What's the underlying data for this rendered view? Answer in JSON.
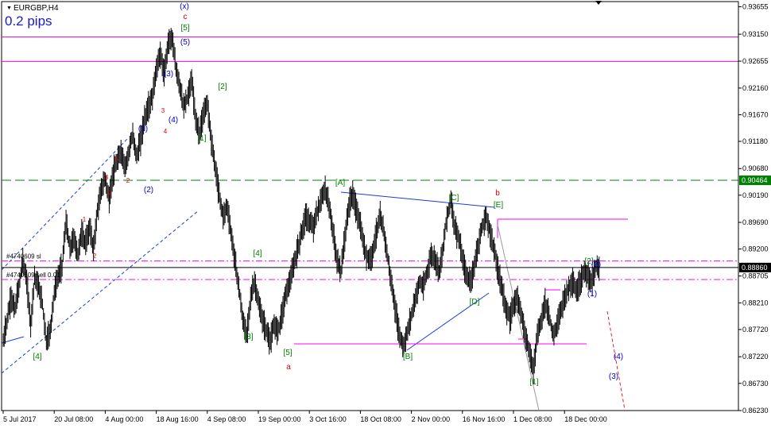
{
  "window": {
    "symbol_title": "EURGBP,H4",
    "spread_label": "0.2 pips",
    "menu_icon": "triangle-down-icon"
  },
  "chart_data": {
    "type": "candlestick-line",
    "symbol": "EURGBP",
    "timeframe": "H4",
    "ylim": [
      0.8623,
      0.9375
    ],
    "y_ticks": [
      "0.93655",
      "0.93150",
      "0.92655",
      "0.92160",
      "0.91670",
      "0.91180",
      "0.90680",
      "0.90190",
      "0.89690",
      "0.89200",
      "0.88705",
      "0.88210",
      "0.87720",
      "0.87220",
      "0.86730",
      "0.86230"
    ],
    "x_ticks": [
      "5 Jul 2017",
      "20 Jul 08:00",
      "4 Aug 00:00",
      "18 Aug 16:00",
      "4 Sep 08:00",
      "19 Sep 00:00",
      "3 Oct 16:00",
      "18 Oct 08:00",
      "2 Nov 00:00",
      "16 Nov 16:00",
      "1 Dec 08:00",
      "18 Dec 00:00"
    ],
    "price_path": [
      0.875,
      0.879,
      0.883,
      0.881,
      0.885,
      0.89,
      0.886,
      0.878,
      0.887,
      0.885,
      0.882,
      0.875,
      0.877,
      0.884,
      0.887,
      0.889,
      0.897,
      0.892,
      0.894,
      0.891,
      0.895,
      0.893,
      0.896,
      0.892,
      0.899,
      0.903,
      0.905,
      0.901,
      0.906,
      0.908,
      0.91,
      0.907,
      0.91,
      0.913,
      0.909,
      0.912,
      0.916,
      0.918,
      0.92,
      0.925,
      0.928,
      0.924,
      0.93,
      0.931,
      0.925,
      0.922,
      0.918,
      0.92,
      0.923,
      0.916,
      0.913,
      0.917,
      0.919,
      0.912,
      0.907,
      0.902,
      0.898,
      0.9,
      0.895,
      0.89,
      0.885,
      0.879,
      0.876,
      0.883,
      0.886,
      0.882,
      0.879,
      0.877,
      0.875,
      0.878,
      0.877,
      0.88,
      0.884,
      0.886,
      0.889,
      0.892,
      0.895,
      0.898,
      0.897,
      0.896,
      0.899,
      0.901,
      0.903,
      0.9,
      0.895,
      0.89,
      0.888,
      0.894,
      0.9,
      0.902,
      0.899,
      0.896,
      0.892,
      0.89,
      0.891,
      0.895,
      0.898,
      0.895,
      0.89,
      0.885,
      0.88,
      0.876,
      0.874,
      0.877,
      0.88,
      0.883,
      0.886,
      0.885,
      0.888,
      0.891,
      0.89,
      0.888,
      0.892,
      0.898,
      0.901,
      0.896,
      0.894,
      0.89,
      0.887,
      0.886,
      0.889,
      0.893,
      0.896,
      0.898,
      0.895,
      0.892,
      0.888,
      0.885,
      0.881,
      0.879,
      0.882,
      0.883,
      0.88,
      0.876,
      0.873,
      0.87,
      0.876,
      0.879,
      0.882,
      0.88,
      0.876,
      0.878,
      0.881,
      0.883,
      0.885,
      0.886,
      0.884,
      0.886,
      0.888,
      0.887,
      0.886,
      0.889,
      0.888
    ],
    "horizontal_lines": [
      {
        "price": 0.931,
        "color": "#ff00ff",
        "style": "solid"
      },
      {
        "price": 0.9265,
        "color": "#ff00ff",
        "style": "solid"
      },
      {
        "price": 0.90464,
        "color": "#008000",
        "style": "dashed",
        "tag": "0.90464"
      },
      {
        "price": 0.8898,
        "color": "#ff00ff",
        "style": "dashdot",
        "label": "#4740609 sl"
      },
      {
        "price": 0.8886,
        "color": "#000000",
        "style": "solid",
        "tag": "0.88860"
      },
      {
        "price": 0.8864,
        "color": "#ff00ff",
        "style": "dashdot",
        "label": "#4740609 sell 0.01"
      }
    ],
    "annotations": [
      {
        "text": "(x)",
        "color": "#0000cc"
      },
      {
        "text": "c",
        "color": "#dd0000"
      },
      {
        "text": "[5]",
        "color": "#008000"
      },
      {
        "text": "(5)",
        "color": "#0000cc"
      },
      {
        "text": "(3)",
        "color": "#0000cc"
      },
      {
        "text": "[2]",
        "color": "#008000"
      },
      {
        "text": "(4)",
        "color": "#0000cc"
      },
      {
        "text": "[1]",
        "color": "#008000"
      },
      {
        "text": "(1)",
        "color": "#0000cc"
      },
      {
        "text": "(2)",
        "color": "#0000cc"
      },
      {
        "text": "5",
        "color": "#dd0000"
      },
      {
        "text": "4",
        "color": "#dd0000"
      },
      {
        "text": "3",
        "color": "#dd0000"
      },
      {
        "text": "2",
        "color": "#dd0000"
      },
      {
        "text": "1",
        "color": "#dd0000"
      },
      {
        "text": "4",
        "color": "#dd0000"
      },
      {
        "text": "3",
        "color": "#dd0000"
      },
      {
        "text": "2",
        "color": "#dd0000"
      },
      {
        "text": "[4]",
        "color": "#008000"
      },
      {
        "text": "[4]",
        "color": "#008000"
      },
      {
        "text": "[3]",
        "color": "#008000"
      },
      {
        "text": "[5]",
        "color": "#008000"
      },
      {
        "text": "a",
        "color": "#dd0000"
      },
      {
        "text": "[A]",
        "color": "#008000"
      },
      {
        "text": "[C]",
        "color": "#008000"
      },
      {
        "text": "b",
        "color": "#dd0000"
      },
      {
        "text": "[E]",
        "color": "#008000"
      },
      {
        "text": "[D]",
        "color": "#008000"
      },
      {
        "text": "[B]",
        "color": "#008000"
      },
      {
        "text": "[1]",
        "color": "#008000"
      },
      {
        "text": "[2]",
        "color": "#008000"
      },
      {
        "text": "(2)",
        "color": "#0000cc"
      },
      {
        "text": "(1)",
        "color": "#0000cc"
      },
      {
        "text": "(4)",
        "color": "#0000cc"
      },
      {
        "text": "(3)",
        "color": "#0000cc"
      }
    ],
    "colors": {
      "candles": "#000000",
      "axis": "#000000",
      "green_tag": "#008000",
      "magenta": "#ff00ff",
      "blue": "#0000cc",
      "red": "#dd0000"
    }
  }
}
